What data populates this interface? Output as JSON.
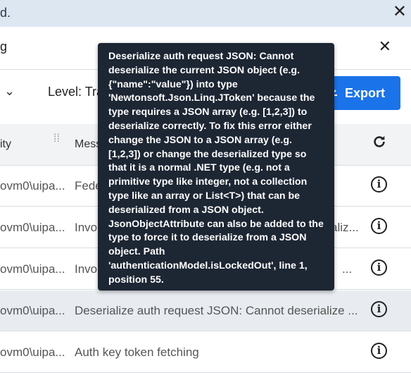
{
  "topbar": {
    "title_fragment": "d.",
    "close_label": "✕"
  },
  "search": {
    "value": "g",
    "clear_label": "✕"
  },
  "filter": {
    "chevron": "⌄",
    "level_label": "Level: Tra"
  },
  "export_button": {
    "label": "Export",
    "icon": "download-icon"
  },
  "table": {
    "headers": {
      "col1": "ity",
      "col2": "Mess"
    },
    "rows": [
      {
        "user": "ovm0\\uipa...",
        "message": "Fede"
      },
      {
        "user": "ovm0\\uipa...",
        "message": "Invo",
        "message_tail": "aliz..."
      },
      {
        "user": "ovm0\\uipa...",
        "message": "Invo",
        "message_tail": "..."
      },
      {
        "user": "ovm0\\uipa...",
        "message": "Deserialize auth request JSON: Cannot deserialize ..."
      },
      {
        "user": "ovm0\\uipa...",
        "message": "Auth key token fetching"
      }
    ]
  },
  "tooltip": {
    "text": "Deserialize auth request JSON: Cannot deserialize the current JSON object (e.g. {\"name\":\"value\"}) into type 'Newtonsoft.Json.Linq.JToken' because the type requires a JSON array (e.g. [1,2,3]) to deserialize correctly. To fix this error either change the JSON to a JSON array (e.g. [1,2,3]) or change the deserialized type so that it is a normal .NET type (e.g. not a primitive type like integer, not a collection type like an array or List<T>) that can be deserialized from a JSON object. JsonObjectAttribute can also be added to the type to force it to deserialize from a JSON object. Path 'authenticationModel.isLockedOut', line 1, position 55."
  },
  "colors": {
    "accent": "#1a73e8",
    "tooltip_bg": "#1d2633",
    "highlight_row": "#e8ecf1"
  }
}
